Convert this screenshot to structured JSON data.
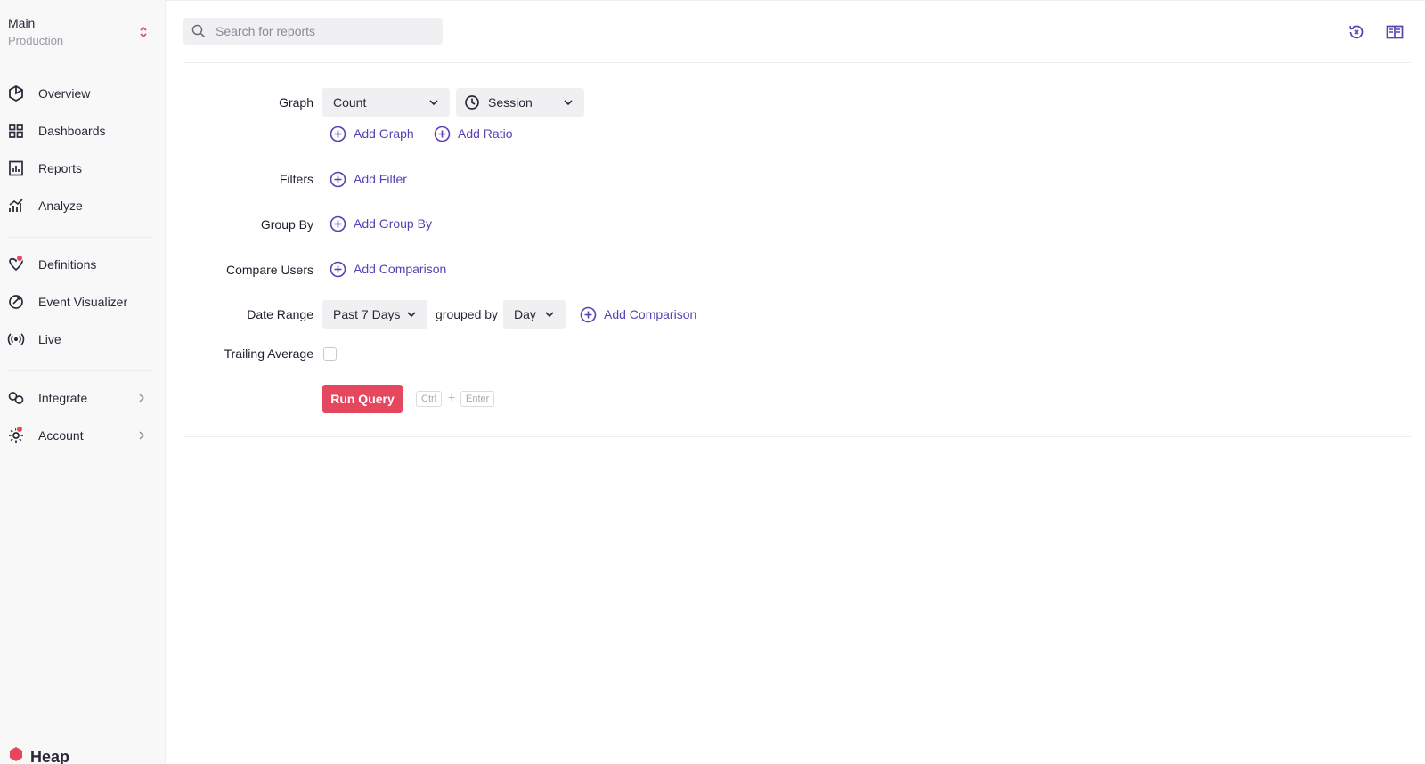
{
  "sidebar": {
    "env": {
      "name": "Main",
      "subtitle": "Production"
    },
    "nav": [
      {
        "label": "Overview",
        "icon": "cube-icon"
      },
      {
        "label": "Dashboards",
        "icon": "grid-icon"
      },
      {
        "label": "Reports",
        "icon": "report-icon"
      },
      {
        "label": "Analyze",
        "icon": "chart-icon"
      },
      {
        "label": "Definitions",
        "icon": "definitions-icon"
      },
      {
        "label": "Event Visualizer",
        "icon": "visualizer-icon"
      },
      {
        "label": "Live",
        "icon": "broadcast-icon"
      },
      {
        "label": "Integrate",
        "icon": "integrate-icon"
      },
      {
        "label": "Account",
        "icon": "gear-icon"
      }
    ],
    "brand": "Heap"
  },
  "search": {
    "placeholder": "Search for reports",
    "value": ""
  },
  "query": {
    "graph": {
      "label": "Graph",
      "aggregate": "Count",
      "unit": "Session",
      "add_graph": "Add Graph",
      "add_ratio": "Add Ratio"
    },
    "filters": {
      "label": "Filters",
      "add": "Add Filter"
    },
    "group_by": {
      "label": "Group By",
      "add": "Add Group By"
    },
    "compare_users": {
      "label": "Compare Users",
      "add": "Add Comparison"
    },
    "date_range": {
      "label": "Date Range",
      "value": "Past 7 Days",
      "grouped_by_text": "grouped by",
      "granularity": "Day",
      "add": "Add Comparison"
    },
    "trailing_average": {
      "label": "Trailing Average",
      "checked": false
    },
    "run": {
      "label": "Run Query",
      "shortcut_key1": "Ctrl",
      "shortcut_plus": "+",
      "shortcut_key2": "Enter"
    }
  },
  "colors": {
    "accent": "#5a3fb3",
    "primary_button": "#e5475f",
    "badge": "#e8475e"
  }
}
